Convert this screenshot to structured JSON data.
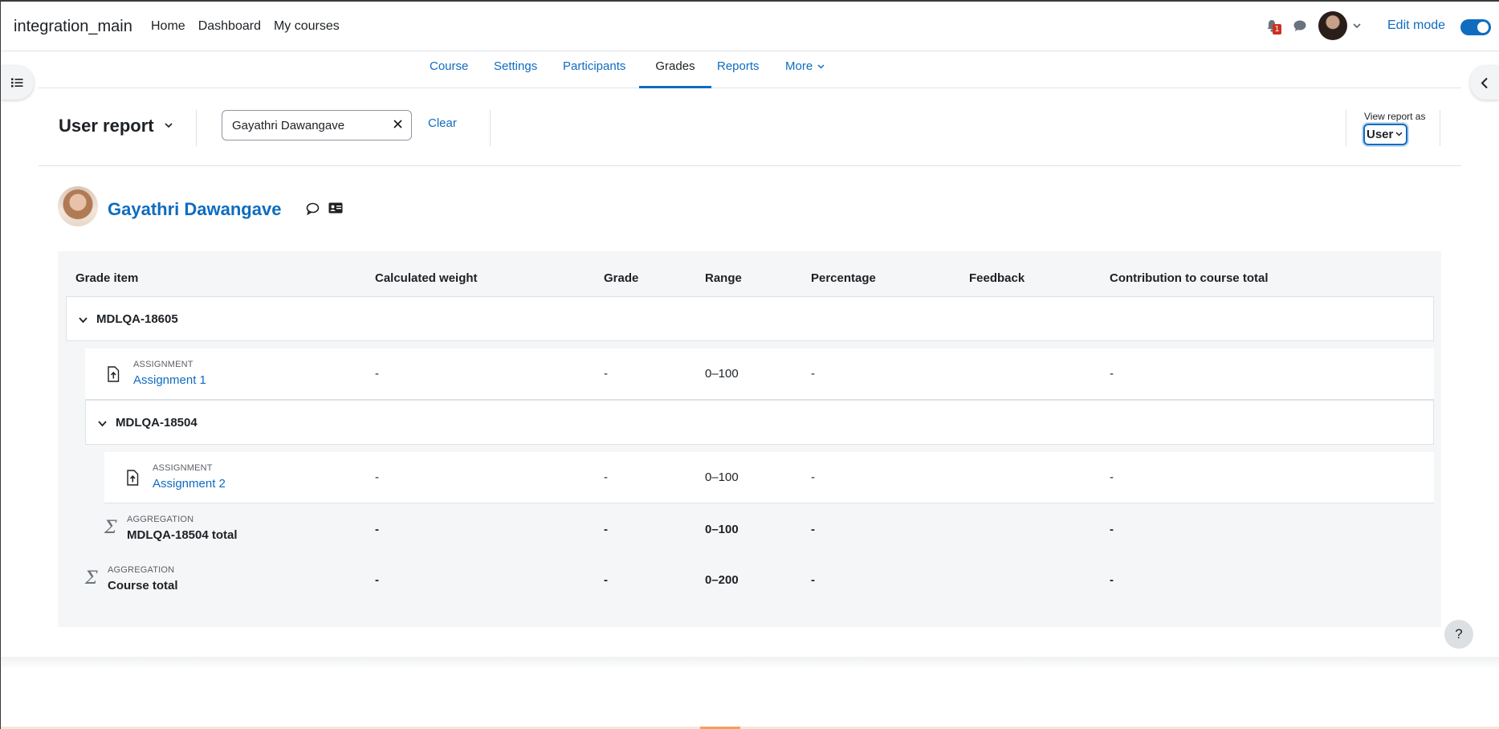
{
  "navbar": {
    "brand": "integration_main",
    "links": [
      "Home",
      "Dashboard",
      "My courses"
    ],
    "notification_count": "1",
    "edit_mode_label": "Edit mode"
  },
  "secondary_nav": {
    "items": [
      "Course",
      "Settings",
      "Participants",
      "Grades",
      "Reports",
      "More"
    ],
    "active": "Grades"
  },
  "report": {
    "title": "User report",
    "search_value": "Gayathri Dawangave",
    "clear_label": "Clear",
    "view_as_label": "View report as",
    "view_as_value": "User"
  },
  "user": {
    "name": "Gayathri Dawangave"
  },
  "table": {
    "headers": [
      "Grade item",
      "Calculated weight",
      "Grade",
      "Range",
      "Percentage",
      "Feedback",
      "Contribution to course total"
    ],
    "category_1": "MDLQA-18605",
    "assignment_1": {
      "type": "ASSIGNMENT",
      "name": "Assignment 1",
      "weight": "-",
      "grade": "-",
      "range": "0–100",
      "percentage": "-",
      "contribution": "-"
    },
    "category_2": "MDLQA-18504",
    "assignment_2": {
      "type": "ASSIGNMENT",
      "name": "Assignment 2",
      "weight": "-",
      "grade": "-",
      "range": "0–100",
      "percentage": "-",
      "contribution": "-"
    },
    "category_2_total": {
      "type": "AGGREGATION",
      "name": "MDLQA-18504 total",
      "weight": "-",
      "grade": "-",
      "range": "0–100",
      "percentage": "-",
      "contribution": "-"
    },
    "course_total": {
      "type": "AGGREGATION",
      "name": "Course total",
      "weight": "-",
      "grade": "-",
      "range": "0–200",
      "percentage": "-",
      "contribution": "-"
    }
  },
  "help_label": "?"
}
